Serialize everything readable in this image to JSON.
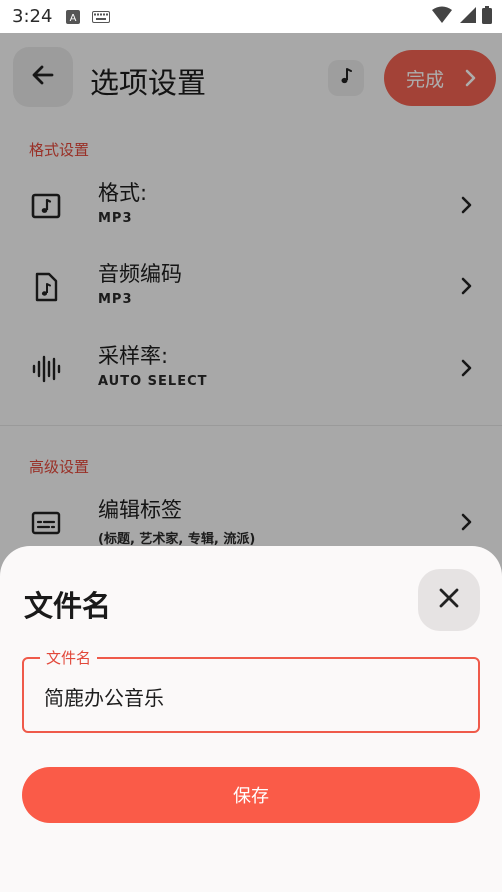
{
  "status_bar": {
    "time": "3:24",
    "icons": [
      "text-a-icon",
      "keyboard-icon",
      "wifi-icon",
      "signal-icon",
      "battery-icon"
    ]
  },
  "header": {
    "back_icon": "arrow-left-icon",
    "title": "选项设置",
    "music_icon": "music-note-icon",
    "done_label": "完成",
    "done_icon": "chevron-right-icon"
  },
  "sections": [
    {
      "title": "格式设置",
      "items": [
        {
          "icon": "music-file-icon",
          "label": "格式:",
          "value": "MP3"
        },
        {
          "icon": "audio-file-icon",
          "label": "音频编码",
          "value": "MP3"
        },
        {
          "icon": "waveform-icon",
          "label": "采样率:",
          "value": "AUTO SELECT"
        }
      ]
    },
    {
      "title": "高级设置",
      "items": [
        {
          "icon": "subtitles-icon",
          "label": "编辑标签",
          "value": "(标题, 艺术家, 专辑, 流派)"
        }
      ]
    }
  ],
  "dialog": {
    "title": "文件名",
    "close_icon": "close-icon",
    "field_label": "文件名",
    "field_value": "简鹿办公音乐",
    "save_label": "保存"
  },
  "colors": {
    "accent": "#f06251",
    "section_title": "#e2483a",
    "save_button": "#fa5b48"
  }
}
